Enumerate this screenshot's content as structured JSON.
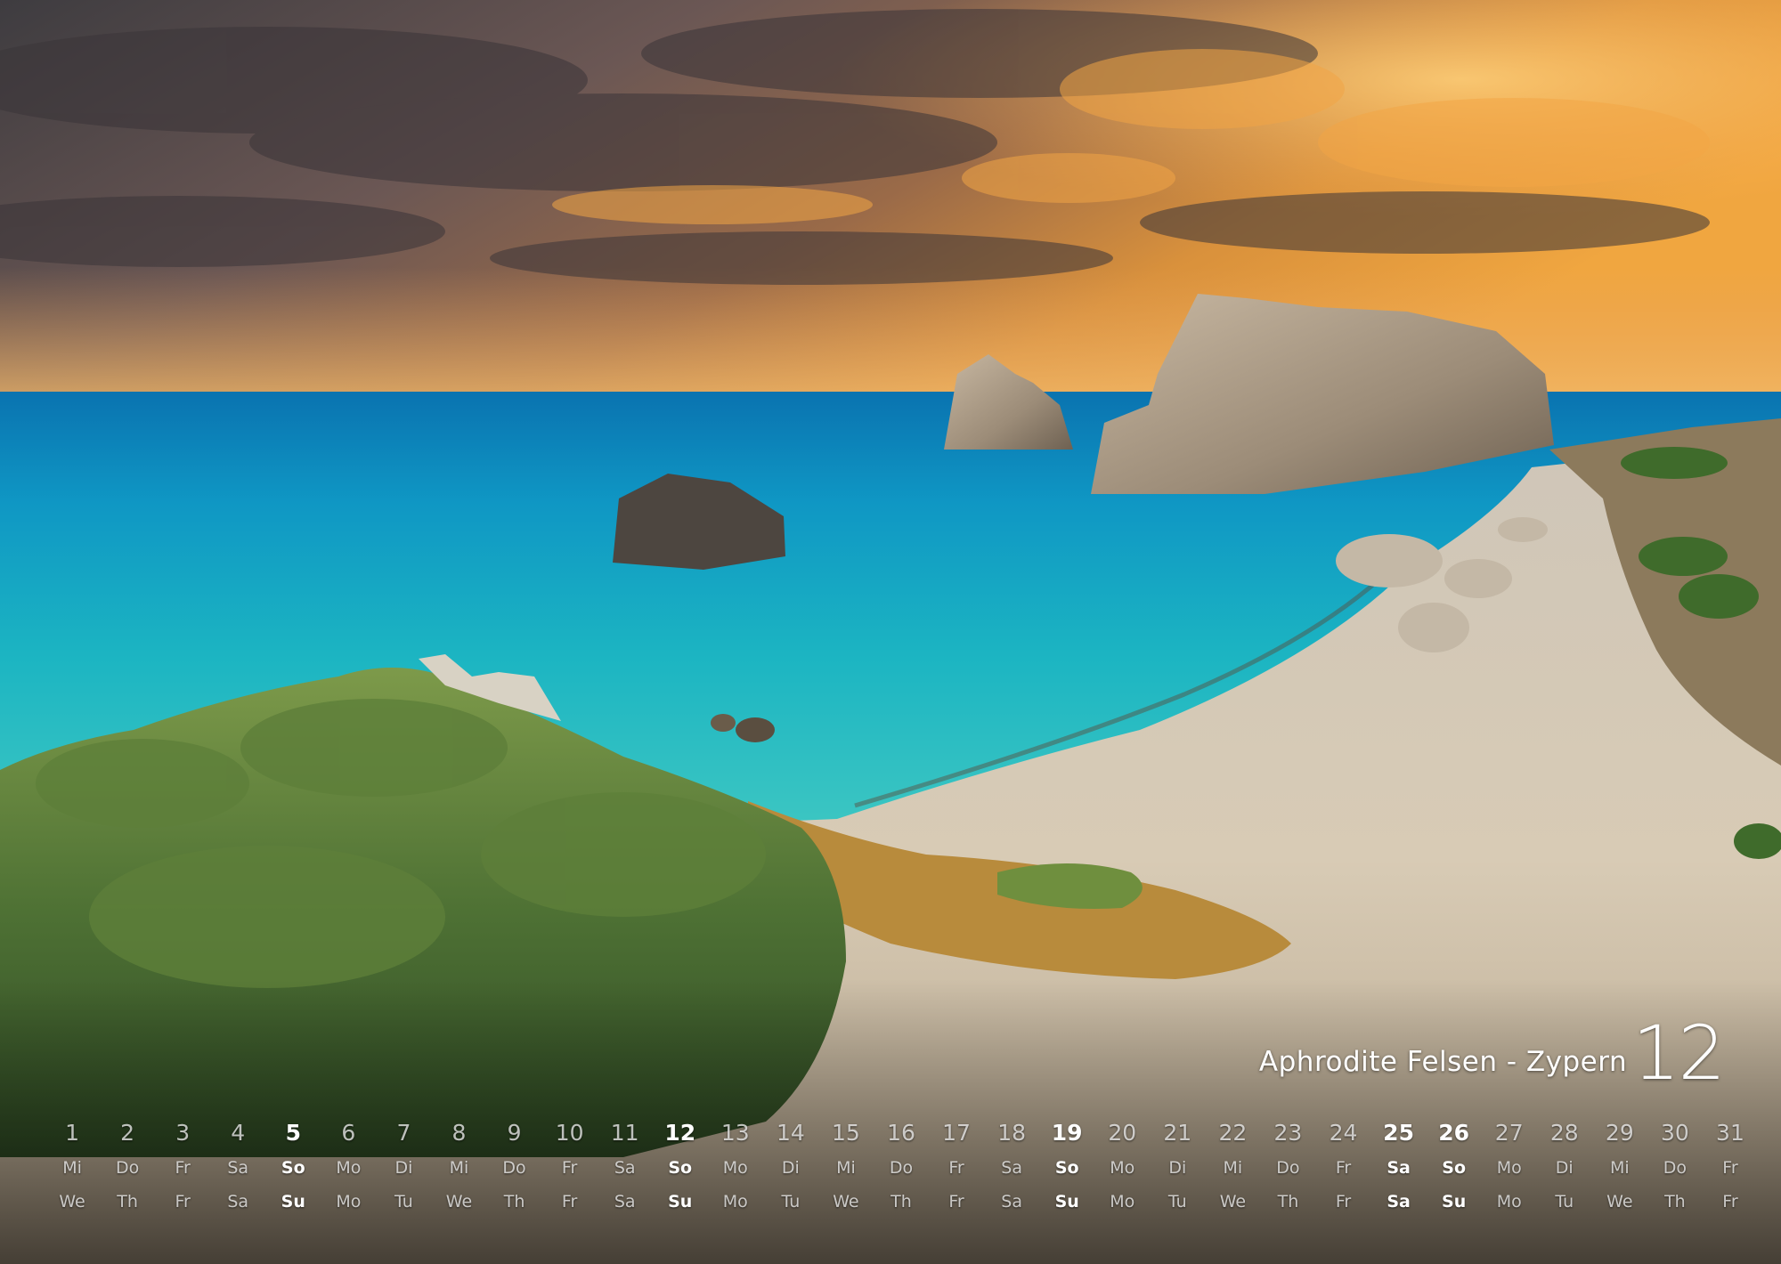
{
  "caption": {
    "title": "Aphrodite Felsen - Zypern",
    "month": "12"
  },
  "calendar": {
    "days": [
      {
        "n": "1",
        "de": "Mi",
        "en": "We",
        "hl": false
      },
      {
        "n": "2",
        "de": "Do",
        "en": "Th",
        "hl": false
      },
      {
        "n": "3",
        "de": "Fr",
        "en": "Fr",
        "hl": false
      },
      {
        "n": "4",
        "de": "Sa",
        "en": "Sa",
        "hl": false
      },
      {
        "n": "5",
        "de": "So",
        "en": "Su",
        "hl": true
      },
      {
        "n": "6",
        "de": "Mo",
        "en": "Mo",
        "hl": false
      },
      {
        "n": "7",
        "de": "Di",
        "en": "Tu",
        "hl": false
      },
      {
        "n": "8",
        "de": "Mi",
        "en": "We",
        "hl": false
      },
      {
        "n": "9",
        "de": "Do",
        "en": "Th",
        "hl": false
      },
      {
        "n": "10",
        "de": "Fr",
        "en": "Fr",
        "hl": false
      },
      {
        "n": "11",
        "de": "Sa",
        "en": "Sa",
        "hl": false
      },
      {
        "n": "12",
        "de": "So",
        "en": "Su",
        "hl": true
      },
      {
        "n": "13",
        "de": "Mo",
        "en": "Mo",
        "hl": false
      },
      {
        "n": "14",
        "de": "Di",
        "en": "Tu",
        "hl": false
      },
      {
        "n": "15",
        "de": "Mi",
        "en": "We",
        "hl": false
      },
      {
        "n": "16",
        "de": "Do",
        "en": "Th",
        "hl": false
      },
      {
        "n": "17",
        "de": "Fr",
        "en": "Fr",
        "hl": false
      },
      {
        "n": "18",
        "de": "Sa",
        "en": "Sa",
        "hl": false
      },
      {
        "n": "19",
        "de": "So",
        "en": "Su",
        "hl": true
      },
      {
        "n": "20",
        "de": "Mo",
        "en": "Mo",
        "hl": false
      },
      {
        "n": "21",
        "de": "Di",
        "en": "Tu",
        "hl": false
      },
      {
        "n": "22",
        "de": "Mi",
        "en": "We",
        "hl": false
      },
      {
        "n": "23",
        "de": "Do",
        "en": "Th",
        "hl": false
      },
      {
        "n": "24",
        "de": "Fr",
        "en": "Fr",
        "hl": false
      },
      {
        "n": "25",
        "de": "Sa",
        "en": "Sa",
        "hl": true
      },
      {
        "n": "26",
        "de": "So",
        "en": "Su",
        "hl": true
      },
      {
        "n": "27",
        "de": "Mo",
        "en": "Mo",
        "hl": false
      },
      {
        "n": "28",
        "de": "Di",
        "en": "Tu",
        "hl": false
      },
      {
        "n": "29",
        "de": "Mi",
        "en": "We",
        "hl": false
      },
      {
        "n": "30",
        "de": "Do",
        "en": "Th",
        "hl": false
      },
      {
        "n": "31",
        "de": "Fr",
        "en": "Fr",
        "hl": false
      }
    ]
  }
}
